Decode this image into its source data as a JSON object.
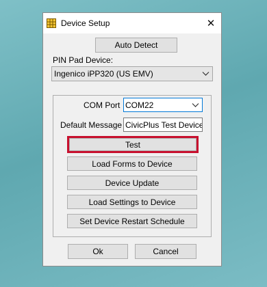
{
  "window": {
    "title": "Device Setup",
    "close_symbol": "✕"
  },
  "auto_detect_label": "Auto Detect",
  "pin_pad": {
    "label": "PIN Pad Device:",
    "selected": "Ingenico iPP320 (US EMV)"
  },
  "com_port": {
    "label": "COM Port",
    "selected": "COM22"
  },
  "default_message": {
    "label": "Default Message",
    "value": "CivicPlus Test Device"
  },
  "buttons": {
    "test": "Test",
    "load_forms": "Load Forms to Device",
    "device_update": "Device Update",
    "load_settings": "Load Settings to Device",
    "restart_schedule": "Set Device Restart Schedule",
    "ok": "Ok",
    "cancel": "Cancel"
  },
  "colors": {
    "highlight": "#c8102e",
    "focus_border": "#0078d7",
    "dialog_bg": "#f0f0f0"
  },
  "icons": {
    "app": "grid-app-icon",
    "close": "close-icon",
    "dropdown": "chevron-down-icon"
  }
}
